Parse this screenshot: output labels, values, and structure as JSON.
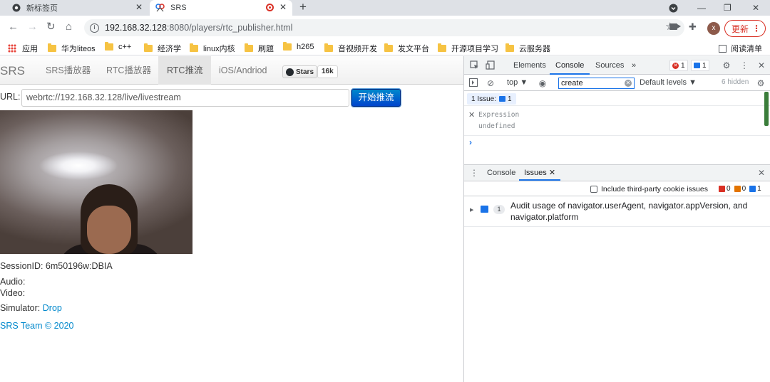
{
  "browser": {
    "tabs": [
      {
        "title": "新标签页",
        "icon": "chrome-icon"
      },
      {
        "title": "SRS",
        "icon": "srs-favicon",
        "recording": true
      }
    ],
    "new_tab_label": "+",
    "window_controls": {
      "minimize": "—",
      "restore": "❐",
      "close": "✕"
    },
    "account_initial": "x",
    "update_label": "更新",
    "address": {
      "host": "192.168.32.128",
      "rest": ":8080/players/rtc_publisher.html"
    },
    "bookmarks": [
      {
        "label": "应用",
        "type": "apps"
      },
      {
        "label": "华为liteos",
        "type": "folder"
      },
      {
        "label": "c++",
        "type": "folder"
      },
      {
        "label": "经济学",
        "type": "folder"
      },
      {
        "label": "linux内核",
        "type": "folder"
      },
      {
        "label": "刷题",
        "type": "folder"
      },
      {
        "label": "h265",
        "type": "folder"
      },
      {
        "label": "音视频开发",
        "type": "folder"
      },
      {
        "label": "发文平台",
        "type": "folder"
      },
      {
        "label": "开源项目学习",
        "type": "folder"
      },
      {
        "label": "云服务器",
        "type": "folder"
      }
    ],
    "reading_list_label": "阅读清单"
  },
  "page": {
    "brand": "SRS",
    "nav": [
      {
        "label": "SRS播放器",
        "active": false
      },
      {
        "label": "RTC播放器",
        "active": false
      },
      {
        "label": "RTC推流",
        "active": true
      },
      {
        "label": "iOS/Andriod",
        "active": false
      }
    ],
    "github": {
      "stars_label": "Stars",
      "count": "16k"
    },
    "url_label": "URL:",
    "url_value": "webrtc://192.168.32.128/live/livestream",
    "publish_button": "开始推流",
    "session_id": "SessionID: 6m50196w:DBIA",
    "audio_label": "Audio:",
    "video_label": "Video:",
    "simulator_label": "Simulator:",
    "simulator_link": "Drop",
    "footer": "SRS Team © 2020"
  },
  "devtools": {
    "tabs": [
      {
        "label": "Elements",
        "active": false
      },
      {
        "label": "Console",
        "active": true
      },
      {
        "label": "Sources",
        "active": false
      }
    ],
    "more_tabs": "»",
    "error_count": "1",
    "message_count": "1",
    "context": "top ▼",
    "filter_value": "create",
    "levels": "Default levels ▼",
    "hidden": "6 hidden",
    "issues_chip": {
      "label": "1 Issue:",
      "count": "1"
    },
    "expression": {
      "label": "Expression",
      "value": "undefined"
    },
    "prompt": "›",
    "drawer": {
      "tabs": [
        {
          "label": "Console",
          "active": false
        },
        {
          "label": "Issues",
          "active": true
        }
      ],
      "third_party_label": "Include third-party cookie issues",
      "counts": {
        "error": "0",
        "warning": "0",
        "info": "1"
      },
      "issue": {
        "count": "1",
        "text": "Audit usage of navigator.userAgent, navigator.appVersion, and navigator.platform"
      }
    }
  }
}
